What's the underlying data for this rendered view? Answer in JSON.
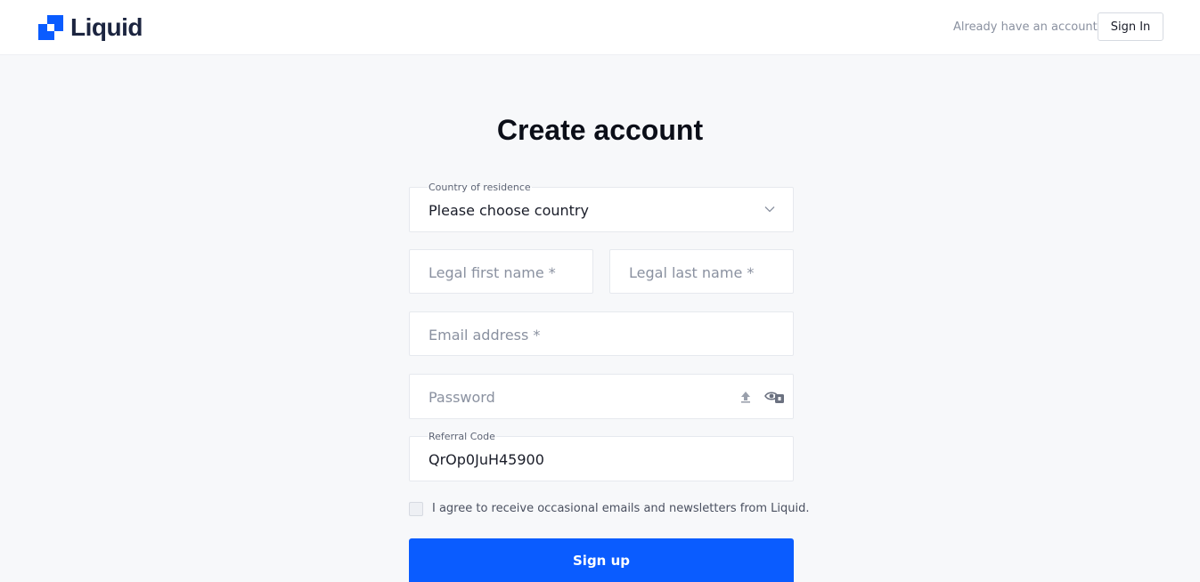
{
  "header": {
    "brand": "Liquid",
    "brand_color": "#0a5cff",
    "logo_icon": "liquid-logo-icon",
    "already_text": "Already have an account",
    "signin_label": "Sign In"
  },
  "form": {
    "title": "Create account",
    "country": {
      "label": "Country of residence",
      "value": "Please choose country",
      "icon": "chevron-down-icon"
    },
    "first_name": {
      "placeholder": "Legal first name *"
    },
    "last_name": {
      "placeholder": "Legal last name *"
    },
    "email": {
      "placeholder": "Email address *"
    },
    "password": {
      "placeholder": "Password",
      "icons": [
        "upload-arrow-icon",
        "eye-key-icon"
      ]
    },
    "referral": {
      "label": "Referral Code",
      "value": "QrOp0JuH45900"
    },
    "agree_text": "I agree to receive occasional emails and newsletters from Liquid.",
    "agree_checked": false,
    "submit_label": "Sign up",
    "submit_color": "#0a5cff"
  }
}
